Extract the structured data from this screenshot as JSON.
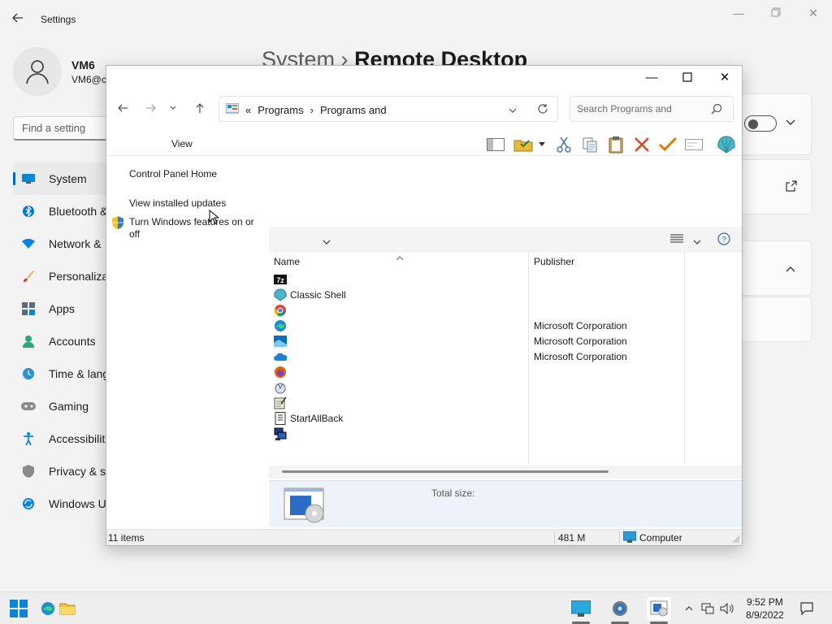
{
  "settings": {
    "title": "Settings",
    "user": {
      "name": "VM6",
      "email": "VM6@c"
    },
    "search_placeholder": "Find a setting",
    "headline": {
      "section": "System",
      "separator": "›",
      "page": "Remote Desktop"
    },
    "nav": [
      {
        "label": "System",
        "icon": "monitor-icon",
        "active": true
      },
      {
        "label": "Bluetooth &",
        "icon": "bluetooth-icon"
      },
      {
        "label": "Network &",
        "icon": "wifi-icon"
      },
      {
        "label": "Personaliza",
        "icon": "brush-icon"
      },
      {
        "label": "Apps",
        "icon": "apps-icon"
      },
      {
        "label": "Accounts",
        "icon": "person-icon"
      },
      {
        "label": "Time & lang",
        "icon": "clock-icon"
      },
      {
        "label": "Gaming",
        "icon": "gamepad-icon"
      },
      {
        "label": "Accessibilit",
        "icon": "accessibility-icon"
      },
      {
        "label": "Privacy & se",
        "icon": "shield-icon"
      },
      {
        "label": "Windows U",
        "icon": "update-icon"
      }
    ]
  },
  "explorer": {
    "breadcrumb": {
      "overflow": "«",
      "items": [
        "Programs",
        "Programs and"
      ]
    },
    "search_placeholder": "Search Programs and",
    "view_menu": "View",
    "left_links": {
      "home": "Control Panel Home",
      "updates": "View installed updates",
      "features": "Turn Windows features on or off"
    },
    "columns": {
      "name": "Name",
      "publisher": "Publisher"
    },
    "programs": [
      {
        "name": "",
        "publisher": "",
        "icon": "7zip-icon"
      },
      {
        "name": "Classic Shell",
        "publisher": "",
        "icon": "shell-icon"
      },
      {
        "name": "",
        "publisher": "",
        "icon": "chrome-icon"
      },
      {
        "name": "",
        "publisher": "Microsoft Corporation",
        "icon": "edge-icon"
      },
      {
        "name": "",
        "publisher": "Microsoft Corporation",
        "icon": "installer-icon"
      },
      {
        "name": "",
        "publisher": "Microsoft Corporation",
        "icon": "onedrive-icon"
      },
      {
        "name": "",
        "publisher": "",
        "icon": "firefox-icon"
      },
      {
        "name": "",
        "publisher": "",
        "icon": "tool-icon"
      },
      {
        "name": "",
        "publisher": "",
        "icon": "notepad-icon"
      },
      {
        "name": "StartAllBack",
        "publisher": "",
        "icon": "startallback-icon"
      },
      {
        "name": "",
        "publisher": "",
        "icon": "vm-tools-icon"
      }
    ],
    "details": {
      "total_size_label": "Total size:"
    },
    "status": {
      "count": "11 items",
      "size": "481 M",
      "location": "Computer"
    }
  },
  "taskbar": {
    "time": "9:52 PM",
    "date": "8/9/2022"
  },
  "colors": {
    "accent": "#0067c0",
    "details_bg": "#eef3fb",
    "delete_red": "#d9482b",
    "check_orange": "#e07b0f"
  }
}
